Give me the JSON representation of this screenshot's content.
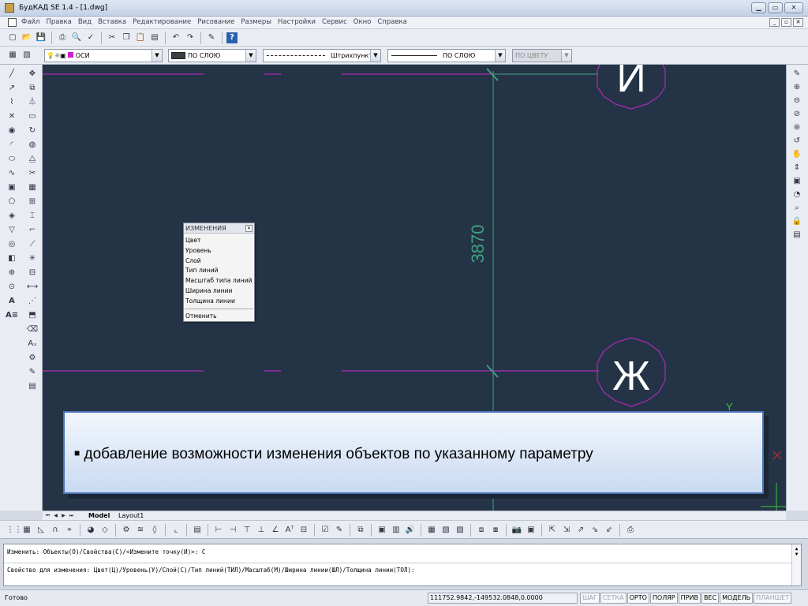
{
  "window": {
    "title": "БудКАД  SE 1.4 - [1.dwg]"
  },
  "menu": [
    "Файл",
    "Правка",
    "Вид",
    "Вставка",
    "Редактирование",
    "Рисование",
    "Размеры",
    "Настройки",
    "Сервис",
    "Окно",
    "Справка"
  ],
  "properties_bar": {
    "layer": "ОСИ",
    "color": "ПО СЛОЮ",
    "linetype": "Штрихпунктирная",
    "lineweight": "ПО СЛОЮ",
    "plotstyle": "ПО ЦВЕТУ"
  },
  "drawing": {
    "dimension_text": "3870",
    "axis_labels": [
      "И",
      "Ж"
    ],
    "ucs_label": "Y",
    "colors": {
      "background": "#243446",
      "axis_line": "#b02ab8",
      "dimension": "#3fa080",
      "text_white": "#ffffff"
    }
  },
  "context_menu": {
    "title": "ИЗМЕНЕНИЯ",
    "items": [
      "Цвет",
      "Уровень",
      "Слой",
      "Тип линий",
      "Масштаб типа линий",
      "Ширина линии",
      "Толщина линии"
    ],
    "cancel": "Отменить"
  },
  "slide_caption": "добавление возможности изменения объектов по указанному параметру",
  "tabs": [
    "Model",
    "Layout1"
  ],
  "command_line": {
    "line1": "Изменить:  Объекты(О)/Свойства(С)/<Измените точку(И)>: С",
    "line2": "Свойство для изменения:  Цвет(Ц)/Уровень(У)/Слой(С)/Тип линий(ТИЛ)/Масштаб(М)/Ширина линии(ШЛ)/Толщина линии(ТОЛ):"
  },
  "status": {
    "text": "Готово",
    "coords": "111752.9842,-149532.0848,0.0000",
    "modes": [
      {
        "label": "ШАГ",
        "on": false
      },
      {
        "label": "СЕТКА",
        "on": false
      },
      {
        "label": "ОРТО",
        "on": true
      },
      {
        "label": "ПОЛЯР",
        "on": true
      },
      {
        "label": "ПРИВ",
        "on": true
      },
      {
        "label": "ВЕС",
        "on": true
      },
      {
        "label": "МОДЕЛЬ",
        "on": true
      },
      {
        "label": "ПЛАНШЕТ",
        "on": false
      }
    ]
  }
}
